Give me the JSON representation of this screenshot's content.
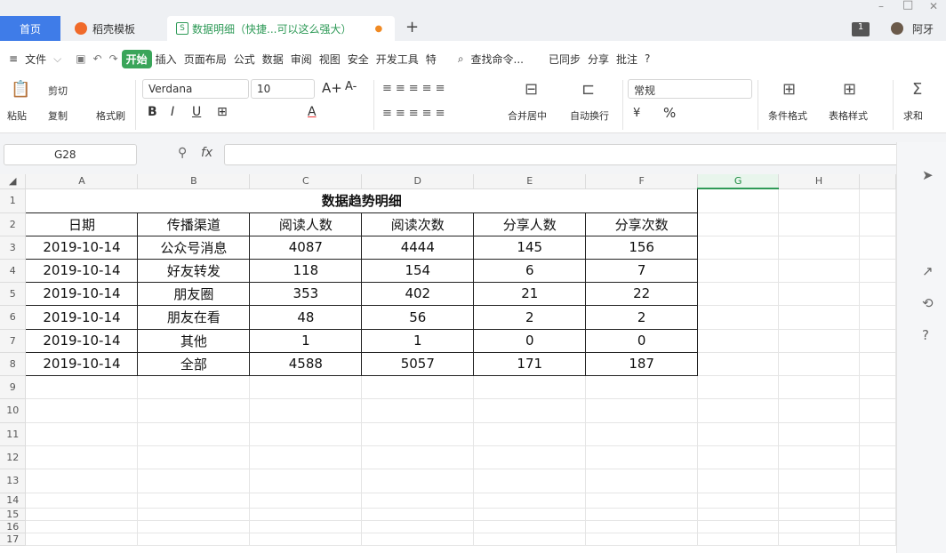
{
  "tabs": [
    {
      "label": "首页"
    },
    {
      "label": "稻壳模板"
    },
    {
      "label": "数据明细（快捷...可以这么强大）"
    }
  ],
  "window": {
    "user": "阿牙",
    "min": "–",
    "max": "□",
    "close": "✕",
    "badge": "1"
  },
  "menu": {
    "file": "文件",
    "start": "开始",
    "items": [
      "插入",
      "页面布局",
      "公式",
      "数据",
      "审阅",
      "视图",
      "安全",
      "开发工具",
      "特"
    ],
    "search": "查找命令...",
    "sync": "已同步",
    "share": "分享",
    "comment": "批注",
    "help": "?"
  },
  "ribbon": {
    "paste": "粘贴",
    "cut": "剪切",
    "copy": "复制",
    "format_painter": "格式刷",
    "font": "Verdana",
    "size": "10",
    "merge": "合并居中",
    "wrap": "自动换行",
    "number_format": "常规",
    "percent": "%",
    "cond": "条件格式",
    "table_style": "表格样式",
    "sum": "求和",
    "fontA": "A",
    "fontA_big": "A+",
    "fontA_small": "A-"
  },
  "formula": {
    "cell": "G28",
    "fx": "fx",
    "value": ""
  },
  "columns": [
    "A",
    "B",
    "C",
    "D",
    "E",
    "F",
    "G",
    "H"
  ],
  "rows": [
    "1",
    "2",
    "3",
    "4",
    "5",
    "6",
    "7",
    "8",
    "9",
    "10",
    "11",
    "12",
    "13",
    "14",
    "15",
    "16",
    "17"
  ],
  "sheet": {
    "title": "数据趋势明细",
    "headers": [
      "日期",
      "传播渠道",
      "阅读人数",
      "阅读次数",
      "分享人数",
      "分享次数"
    ],
    "data": [
      [
        "2019-10-14",
        "公众号消息",
        "4087",
        "4444",
        "145",
        "156"
      ],
      [
        "2019-10-14",
        "好友转发",
        "118",
        "154",
        "6",
        "7"
      ],
      [
        "2019-10-14",
        "朋友圈",
        "353",
        "402",
        "21",
        "22"
      ],
      [
        "2019-10-14",
        "朋友在看",
        "48",
        "56",
        "2",
        "2"
      ],
      [
        "2019-10-14",
        "其他",
        "1",
        "1",
        "0",
        "0"
      ],
      [
        "2019-10-14",
        "全部",
        "4588",
        "5057",
        "171",
        "187"
      ]
    ]
  }
}
